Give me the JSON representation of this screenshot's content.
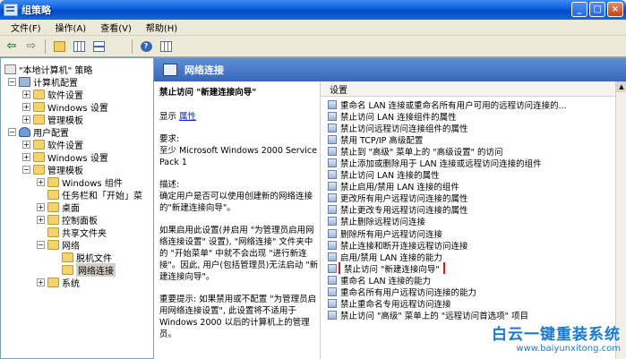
{
  "window": {
    "title": "组策略",
    "buttons": {
      "minimize": "_",
      "maximize": "□",
      "close": "×"
    }
  },
  "menu": [
    "文件(F)",
    "操作(A)",
    "查看(V)",
    "帮助(H)"
  ],
  "toolbar": {
    "back": "⇦",
    "forward": "⇨"
  },
  "tree": {
    "root": "\"本地计算机\" 策略",
    "nodes": [
      {
        "label": "计算机配置"
      },
      {
        "label": "软件设置"
      },
      {
        "label": "Windows 设置"
      },
      {
        "label": "管理模板"
      },
      {
        "label": "用户配置"
      },
      {
        "label": "软件设置"
      },
      {
        "label": "Windows 设置"
      },
      {
        "label": "管理模板"
      },
      {
        "label": "Windows 组件"
      },
      {
        "label": "任务栏和「开始」菜"
      },
      {
        "label": "桌面"
      },
      {
        "label": "控制面板"
      },
      {
        "label": "共享文件夹"
      },
      {
        "label": "网络"
      },
      {
        "label": "脱机文件"
      },
      {
        "label": "网络连接"
      },
      {
        "label": "系统"
      }
    ]
  },
  "header": {
    "title": "网络连接"
  },
  "description": {
    "policy_title": "禁止访问 \"新建连接向导\"",
    "show_label": "显示",
    "show_link": "属性",
    "requirements": "要求:",
    "requirements_value": "至少 Microsoft Windows 2000 Service Pack 1",
    "desc_label": "描述:",
    "desc_value": "确定用户是否可以使用创建新的网络连接的\"新建连接向导\"。",
    "para2": "如果启用此设置(并启用 \"为管理员启用网络连接设置\" 设置), \"网络连接\" 文件夹中的 \"开始菜单\" 中就不会出现 \"进行新连接\"。因此, 用户(包括管理员)无法启动 \"新建连接向导\"。",
    "para3": "重要提示: 如果禁用或不配置 \"为管理员启用网络连接设置\", 此设置将不适用于 Windows 2000 以后的计算机上的管理员。"
  },
  "list": {
    "column": "设置",
    "rows": [
      "重命名 LAN 连接或重命名所有用户可用的远程访问连接的...",
      "禁止访问 LAN 连接组件的属性",
      "禁止访问远程访问连接组件的属性",
      "禁用 TCP/IP 高级配置",
      "禁止到 \"高级\" 菜单上的 \"高级设置\" 的访问",
      "禁止添加或删除用于 LAN 连接或远程访问连接的组件",
      "禁止访问 LAN 连接的属性",
      "禁止启用/禁用 LAN 连接的组件",
      "更改所有用户远程访问连接的属性",
      "禁止更改专用远程访问连接的属性",
      "禁止删除远程访问连接",
      "删除所有用户远程访问连接",
      "禁止连接和断开连接远程访问连接",
      "启用/禁用 LAN 连接的能力",
      "禁止访问 \"新建连接向导\"",
      "重命名 LAN 连接的能力",
      "重命名所有用户远程访问连接的能力",
      "禁止重命名专用远程访问连接",
      "禁止访问 \"高级\" 菜单上的 \"远程访问首选项\" 项目"
    ]
  },
  "watermark": {
    "main": "白云一键重装系统",
    "sub": "www.baiyunxitong.com"
  }
}
